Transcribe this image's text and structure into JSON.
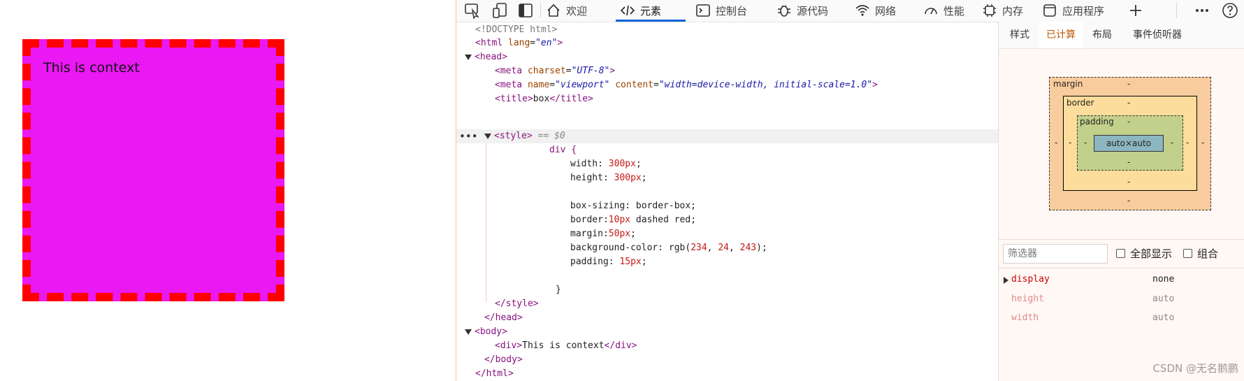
{
  "preview": {
    "text": "This is context"
  },
  "toolbar": {
    "tabs": [
      {
        "label": "欢迎",
        "icon": "home-icon"
      },
      {
        "label": "元素",
        "icon": "code-icon"
      },
      {
        "label": "控制台",
        "icon": "console-icon"
      },
      {
        "label": "源代码",
        "icon": "bug-icon"
      },
      {
        "label": "网络",
        "icon": "wifi-icon"
      },
      {
        "label": "性能",
        "icon": "gauge-icon"
      },
      {
        "label": "内存",
        "icon": "chip-icon"
      },
      {
        "label": "应用程序",
        "icon": "app-icon"
      }
    ],
    "active_tab": "元素",
    "tools": [
      "inspect-icon",
      "device-emulation-icon",
      "dock-icon",
      "add-tab-icon",
      "more-icon",
      "help-icon"
    ]
  },
  "dom": {
    "doctype": "<!DOCTYPE html>",
    "html_tag": "html",
    "html_attr_name": "lang",
    "html_attr_value": "\"en\"",
    "head_tag": "head",
    "meta1_attr": "charset",
    "meta1_value": "\"UTF-8\"",
    "meta2_attr1": "name",
    "meta2_value1": "\"viewport\"",
    "meta2_attr2": "content",
    "meta2_value2": "\"width=device-width, initial-scale=1.0\"",
    "title_text": "box",
    "style_tag": "style",
    "style_marker": "== $0",
    "css_selector": "div {",
    "css_width": "width: ",
    "css_width_val": "300px",
    "css_height": "height: ",
    "css_height_val": "300px",
    "css_boxsizing": "box-sizing: border-box;",
    "css_border": "border:",
    "css_border_val": "10px",
    "css_border_rest": " dashed red;",
    "css_margin": "margin:",
    "css_margin_val": "50px",
    "css_bg": "background-color: rgb(",
    "css_bg_r": "234",
    "css_bg_g": "24",
    "css_bg_b": "243",
    "css_padding": "padding: ",
    "css_padding_val": "15px",
    "css_close": "}",
    "body_tag": "body",
    "div_text": "This is context"
  },
  "sidebar": {
    "tabs": [
      "样式",
      "已计算",
      "布局",
      "事件侦听器"
    ],
    "active_tab": "已计算",
    "box_model": {
      "margin_label": "margin",
      "border_label": "border",
      "padding_label": "padding",
      "content": "auto×auto",
      "dash": "-"
    },
    "filter": {
      "placeholder": "筛选器",
      "show_all": "全部显示",
      "group": "组合"
    },
    "properties": [
      {
        "name": "display",
        "value": "none"
      },
      {
        "name": "height",
        "value": "auto"
      },
      {
        "name": "width",
        "value": "auto"
      }
    ]
  },
  "watermark": "CSDN @无名鹅鹏"
}
